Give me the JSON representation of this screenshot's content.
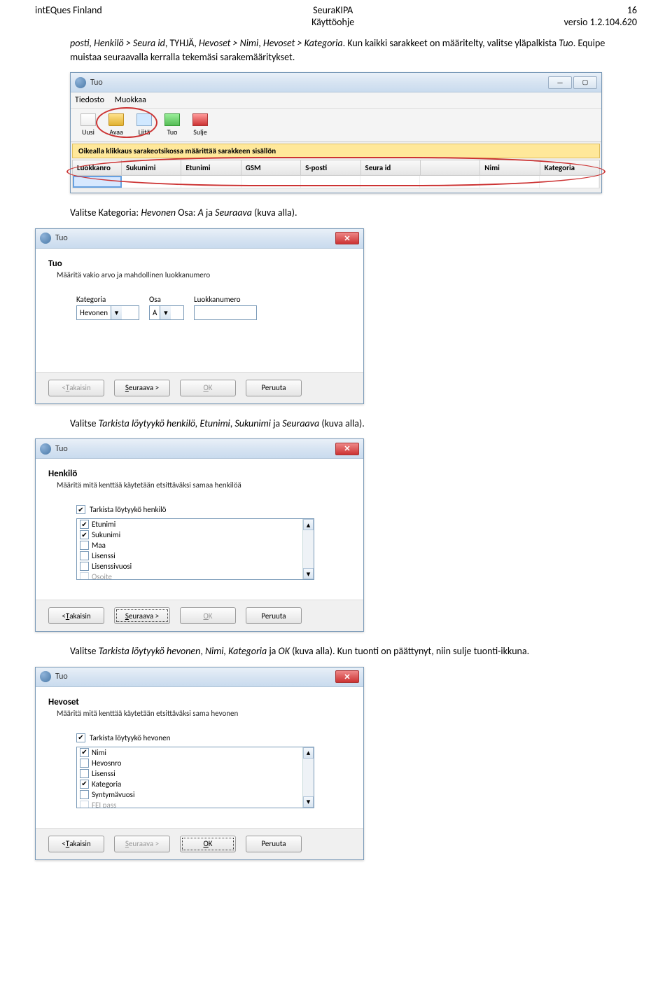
{
  "header": {
    "left": "intEQues Finland",
    "center_line1": "SeuraKIPA",
    "center_line2": "Käyttöohje",
    "right_line1": "16",
    "right_line2": "versio 1.2.104.620"
  },
  "intro_text": {
    "p1_a": "posti, Henkilö > Seura id",
    "p1_b": ", TYHJÄ, ",
    "p1_c": "Hevoset > Nimi",
    "p1_d": ", ",
    "p1_e": "Hevoset > Kategoria",
    "p1_f": ". Kun kaikki sarakkeet on määritelty, valitse yläpalkista ",
    "p1_g": "Tuo",
    "p1_h": ". Equipe muistaa seuraavalla kerralla tekemäsi sarakemääritykset."
  },
  "tuo_main": {
    "title": "Tuo",
    "menu": {
      "tiedosto": "Tiedosto",
      "muokkaa": "Muokkaa"
    },
    "toolbar": {
      "uusi": "Uusi",
      "avaa": "Avaa",
      "liita": "Liitä",
      "tuo": "Tuo",
      "sulje": "Sulje"
    },
    "infobar": "Oikealla klikkaus sarakeotsikossa määrittää sarakkeen sisällön",
    "columns": [
      "Luokkanro",
      "Sukunimi",
      "Etunimi",
      "GSM",
      "S-posti",
      "Seura id",
      "",
      "Nimi",
      "Kategoria"
    ]
  },
  "caption1": "Valitse Kategoria: Hevonen Osa: A ja Seuraava (kuva alla).",
  "tuo_step": {
    "title": "Tuo",
    "head": "Tuo",
    "sub": "Määritä vakio arvo ja mahdollinen luokkanumero",
    "labels": {
      "kategoria": "Kategoria",
      "osa": "Osa",
      "luokkanumero": "Luokkanumero"
    },
    "values": {
      "kategoria": "Hevonen",
      "osa": "A",
      "luokkanumero": ""
    },
    "buttons": {
      "back": "< Takaisin",
      "next": "Seuraava >",
      "ok": "OK",
      "cancel": "Peruuta"
    }
  },
  "caption2": "Valitse Tarkista löytyykö henkilö, Etunimi, Sukunimi ja Seuraava (kuva alla).",
  "henkilo_step": {
    "title": "Tuo",
    "head": "Henkilö",
    "sub": "Määritä mitä kenttää käytetään etsittäväksi samaa henkilöä",
    "checkbox_label": "Tarkista löytyykö henkilö",
    "items": [
      "Etunimi",
      "Sukunimi",
      "Maa",
      "Lisenssi",
      "Lisenssivuosi",
      "Osoite"
    ],
    "checked": [
      true,
      true,
      false,
      false,
      false,
      false
    ],
    "buttons": {
      "back": "< Takaisin",
      "next": "Seuraava >",
      "ok": "OK",
      "cancel": "Peruuta"
    }
  },
  "caption3": "Valitse Tarkista löytyykö hevonen, Nimi, Kategoria ja OK (kuva alla). Kun tuonti on päättynyt, niin sulje tuonti-ikkuna.",
  "hevoset_step": {
    "title": "Tuo",
    "head": "Hevoset",
    "sub": "Määritä mitä kenttää käytetään etsittäväksi sama hevonen",
    "checkbox_label": "Tarkista löytyykö hevonen",
    "items": [
      "Nimi",
      "Hevosnro",
      "Lisenssi",
      "Kategoria",
      "Syntymävuosi",
      "FEI pass"
    ],
    "checked": [
      true,
      false,
      false,
      true,
      false,
      false
    ],
    "buttons": {
      "back": "< Takaisin",
      "next": "Seuraava >",
      "ok": "OK",
      "cancel": "Peruuta"
    }
  }
}
